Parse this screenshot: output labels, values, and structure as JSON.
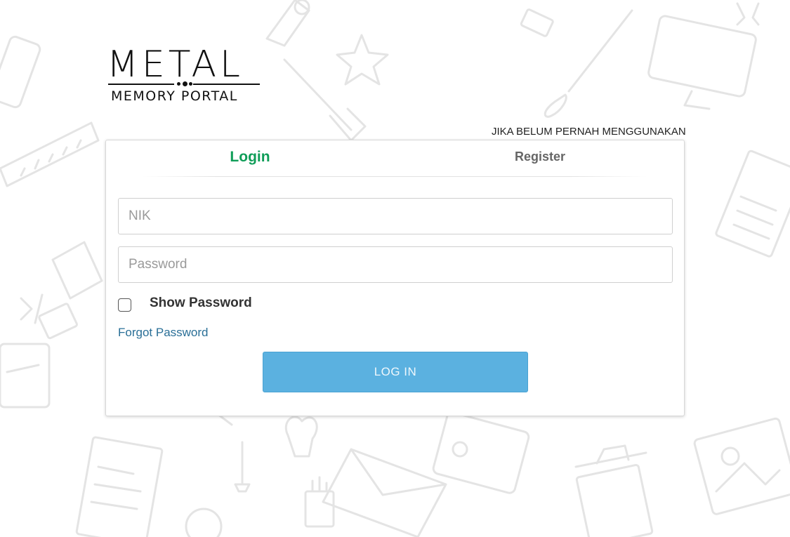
{
  "logo": {
    "word": "METAL",
    "subtitle": "MEMORY PORTAL"
  },
  "notice": {
    "text": "JIKA BELUM PERNAH MENGGUNAKAN"
  },
  "tabs": [
    {
      "label": "Login",
      "active": true
    },
    {
      "label": "Register",
      "active": false
    }
  ],
  "form": {
    "nik": {
      "value": "",
      "placeholder": "NIK"
    },
    "password": {
      "value": "",
      "placeholder": "Password"
    },
    "show_password": {
      "label": "Show Password",
      "checked": false
    },
    "forgot_password": "Forgot Password",
    "submit_label": "LOG IN"
  },
  "colors": {
    "active_tab": "#0f9d58",
    "button": "#5bb1e0",
    "link": "#2a6f97"
  }
}
